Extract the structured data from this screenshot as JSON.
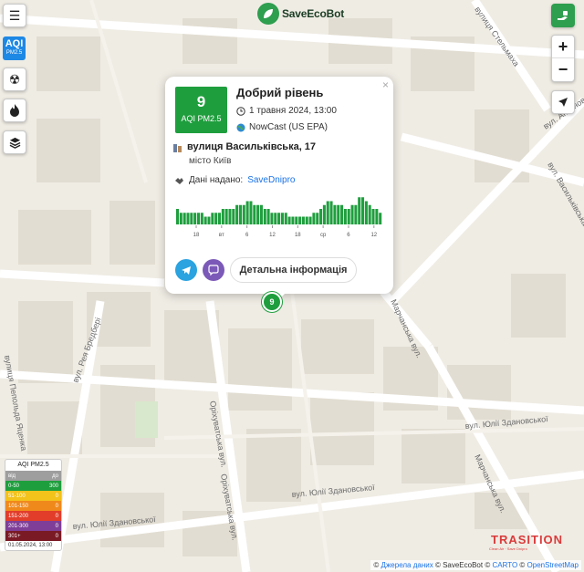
{
  "app": {
    "logo_text": "SaveEcoBot"
  },
  "controls": {
    "menu_icon": "menu-icon",
    "aqi_label": "AQI",
    "aqi_sub": "PM2.5",
    "layers": [
      "radiation-icon",
      "fire-icon",
      "layers-icon"
    ],
    "zoom_in": "+",
    "zoom_out": "−"
  },
  "popup": {
    "aqi_value": "9",
    "aqi_unit": "AQI PM2.5",
    "level_title": "Добрий рівень",
    "timestamp": "1 травня 2024, 13:00",
    "method": "NowCast (US EPA)",
    "address": "вулиця Васильківська, 17",
    "city": "місто Київ",
    "provider_label": "Дані надано:",
    "provider_name": "SaveDnipro",
    "detail_button": "Детальна інформація",
    "close": "×",
    "colors": {
      "good": "#1f9e3e"
    }
  },
  "chart_data": {
    "type": "bar",
    "x_tick_labels": [
      "18",
      "вт",
      "6",
      "12",
      "18",
      "ср",
      "6",
      "12"
    ],
    "values": [
      4,
      3,
      3,
      3,
      3,
      3,
      3,
      3,
      2,
      2,
      3,
      3,
      3,
      4,
      4,
      4,
      4,
      5,
      5,
      5,
      6,
      6,
      5,
      5,
      5,
      4,
      4,
      3,
      3,
      3,
      3,
      3,
      2,
      2,
      2,
      2,
      2,
      2,
      2,
      3,
      3,
      4,
      5,
      6,
      6,
      5,
      5,
      5,
      4,
      4,
      5,
      5,
      7,
      7,
      6,
      5,
      4,
      4,
      3
    ],
    "color": "#1f9e3e"
  },
  "marker": {
    "value": "9"
  },
  "legend": {
    "title": "AQI PM2.5",
    "header": [
      "від",
      "до"
    ],
    "rows": [
      {
        "range": "0-50",
        "count": "300",
        "color": "#1f9e3e"
      },
      {
        "range": "51-100",
        "count": "0",
        "color": "#f3c21b"
      },
      {
        "range": "101-150",
        "count": "0",
        "color": "#f0891c"
      },
      {
        "range": "151-200",
        "count": "0",
        "color": "#e23d2b"
      },
      {
        "range": "201-300",
        "count": "0",
        "color": "#7f3f98"
      },
      {
        "range": "301+",
        "count": "0",
        "color": "#7a1a24"
      }
    ],
    "date": "01.05.2024, 13:00"
  },
  "streets": {
    "vasylkivska": "вул. Васильківська",
    "antonovycha": "вул. Антоновича",
    "stelmakha": "вулиця Стельмаха",
    "mytropolyta": "вул. Рея Бредбері",
    "yatsenka": "вулиця Пепольда Яценка",
    "orikhuvatska": "Оріхуватська вул.",
    "orikhuvatska2": "Оріхуватська вул.",
    "zdanovskoi1": "вул. Юлії Здановської",
    "zdanovskoi2": "вул. Юлії Здановської",
    "zdanovskoi3": "вул. Юлії Здановської",
    "marchanska1": "Марчанська вул.",
    "marchanska2": "Марчанська вул."
  },
  "attribution": {
    "prefix": "© ",
    "sources": "Джерела даних",
    "rest": " © SaveEcoBot © ",
    "carto": "CARTO",
    "sep": " © ",
    "osm": "OpenStreetMap"
  },
  "brand": {
    "name": "TRASITION",
    "sub": "Clean Air · Save Dnipro"
  }
}
